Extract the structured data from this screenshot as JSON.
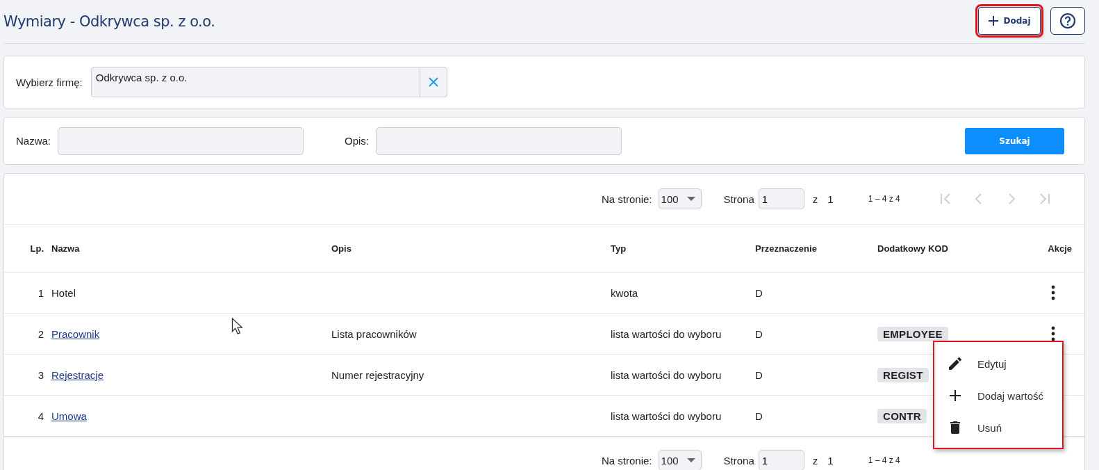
{
  "page": {
    "title": "Wymiary - Odkrywca sp. z o.o.",
    "add_button": "Dodaj"
  },
  "company_filter": {
    "label": "Wybierz firmę:",
    "value": "Odkrywca sp. z o.o."
  },
  "search": {
    "fields": [
      {
        "label": "Nazwa:"
      },
      {
        "label": "Opis:"
      }
    ],
    "button": "Szukaj"
  },
  "pagers": [
    {
      "per_page_label": "Na stronie:",
      "per_page": "100",
      "page_label": "Strona",
      "page": "1",
      "of_label": "z",
      "pages": "1",
      "range": "1 – 4 z 4",
      "nav_disabled": true
    },
    {
      "per_page_label": "Na stronie:",
      "per_page": "100",
      "page_label": "Strona",
      "page": "1",
      "of_label": "z",
      "pages": "1",
      "range": "1 – 4 z 4"
    }
  ],
  "table": {
    "columns": [
      "Lp.",
      "Nazwa",
      "Opis",
      "Typ",
      "Przeznaczenie",
      "Dodatkowy KOD",
      "Akcje"
    ],
    "rows": [
      {
        "lp": "1",
        "name": "Hotel",
        "link": false,
        "type": "kwota",
        "purpose": "D"
      },
      {
        "lp": "2",
        "name": "Pracownik",
        "link": true,
        "description": "Lista pracowników",
        "type": "lista wartości do wyboru",
        "purpose": "D",
        "code": "EMPLOYEE"
      },
      {
        "lp": "3",
        "name": "Rejestracje",
        "link": true,
        "description": "Numer rejestracyjny",
        "type": "lista wartości do wyboru",
        "purpose": "D",
        "code": "REGIST"
      },
      {
        "lp": "4",
        "name": "Umowa",
        "link": true,
        "type": "lista wartości do wyboru",
        "purpose": "D",
        "code": "CONTR"
      }
    ]
  },
  "menu": {
    "open": true,
    "items": [
      {
        "kind": "edit",
        "label": "Edytuj"
      },
      {
        "kind": "add",
        "label": "Dodaj wartość"
      },
      {
        "kind": "delete",
        "label": "Usuń"
      }
    ]
  }
}
